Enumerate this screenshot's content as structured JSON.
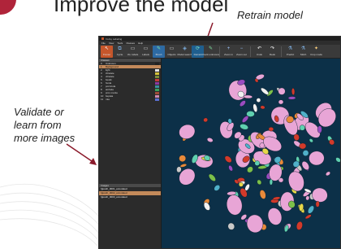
{
  "slide": {
    "headline": "Improve the model",
    "annotations": {
      "retrain": "Retrain model",
      "validate": "Validate or learn from more images"
    },
    "colors": {
      "badge": "#b0243a",
      "arrow": "#8b1a2b"
    }
  },
  "window": {
    "title": "ImJoy Labeling",
    "menu": [
      "File",
      "View",
      "Tools",
      "Classes",
      "Help"
    ],
    "toolbar": [
      {
        "icon": "pointer-icon",
        "label": "Pointer",
        "state": "active"
      },
      {
        "icon": "layers-icon",
        "label": "Cycle",
        "state": ""
      },
      {
        "icon": "window-icon",
        "label": "Vis. labels",
        "state": ""
      },
      {
        "icon": "window-icon",
        "label": "Labels",
        "state": ""
      },
      {
        "icon": "brush-icon",
        "label": "Brush",
        "state": "active2"
      },
      {
        "icon": "window-icon",
        "label": "Objects",
        "state": ""
      },
      {
        "icon": "model-icon",
        "label": "Model search",
        "state": ""
      },
      {
        "icon": "retrain-icon",
        "label": "Retrain",
        "state": "hl"
      },
      {
        "icon": "brush-icon",
        "label": "Check unknowns",
        "state": ""
      },
      {
        "icon": "zoom-in-icon",
        "label": "Zoom in",
        "state": ""
      },
      {
        "icon": "zoom-out-icon",
        "label": "Zoom out",
        "state": ""
      },
      {
        "icon": "undo-icon",
        "label": "Undo",
        "state": ""
      },
      {
        "icon": "redo-icon",
        "label": "Redo",
        "state": ""
      },
      {
        "icon": "flask-icon",
        "label": "Predict",
        "state": ""
      },
      {
        "icon": "flask-icon",
        "label": "Stitch",
        "state": ""
      },
      {
        "icon": "wand-icon",
        "label": "Crop mode",
        "state": ""
      }
    ],
    "classes_header": "Classes",
    "classes": [
      {
        "num": "0",
        "name": "Unknown",
        "color": "#222222"
      },
      {
        "num": "1",
        "name": "Background",
        "color": "#c48a5a"
      },
      {
        "num": "2",
        "name": "light",
        "color": "#e3e3e3"
      },
      {
        "num": "3",
        "name": "zitrelate",
        "color": "#d6c23a"
      },
      {
        "num": "4",
        "name": "vitrelate",
        "color": "#7c8f3a"
      },
      {
        "num": "5",
        "name": "bewik",
        "color": "#c33c3c"
      },
      {
        "num": "6",
        "name": "huxla",
        "color": "#8c3aa0"
      },
      {
        "num": "7",
        "name": "pornicula",
        "color": "#3a8fa0"
      },
      {
        "num": "8",
        "name": "ambela",
        "color": "#3aa05a"
      },
      {
        "num": "9",
        "name": "prox mante",
        "color": "#a04c3a"
      },
      {
        "num": "10",
        "name": "bepata",
        "color": "#d08ab2"
      },
      {
        "num": "11",
        "name": "mia",
        "color": "#5a6fd0"
      }
    ],
    "images_header": "Images",
    "images": [
      "fgtooth_0001_annotated",
      "fgtooth_0002_annotated",
      "fgtooth_0003_annotated"
    ]
  }
}
